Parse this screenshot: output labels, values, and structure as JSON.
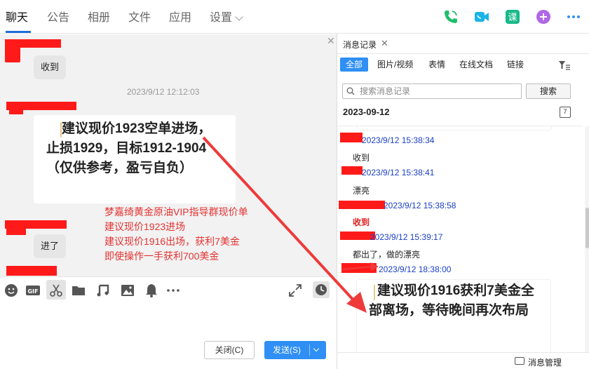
{
  "tabs": [
    {
      "label": "聊天",
      "active": true
    },
    {
      "label": "公告"
    },
    {
      "label": "相册"
    },
    {
      "label": "文件"
    },
    {
      "label": "应用"
    },
    {
      "label": "设置"
    }
  ],
  "top_icons": [
    "phone-icon",
    "video-call-icon",
    "lesson-icon",
    "add-app-icon",
    "more-icon"
  ],
  "chat": {
    "bubble1": "收到",
    "timestamp": "2023/9/12 12:12:03",
    "card_text": "建议现价1923空单进场，止损1929，目标1912-1904（仅供参考，盈亏自负）",
    "bubble2": "进了",
    "overlay_lines": [
      "梦嘉绮黄金原油VIP指导群现价单",
      "建议现价1923进场",
      "建议现价1916出场，获利7美金",
      "即使操作一手获利700美金"
    ]
  },
  "toolbar_icons": [
    "emoji-icon",
    "gif-icon",
    "scissors-icon",
    "folder-icon",
    "music-icon",
    "image-icon",
    "bell-icon",
    "more-dots-icon",
    "expand-icon",
    "clock-icon"
  ],
  "buttons": {
    "close": "关闭(C)",
    "send": "发送(S)"
  },
  "history": {
    "tab_label": "消息记录",
    "filters": [
      "全部",
      "图片/视频",
      "表情",
      "在线文档",
      "链接"
    ],
    "search_placeholder": "搜索消息记录",
    "search_button": "搜索",
    "date": "2023-09-12",
    "calendar_day": "7",
    "entries": [
      {
        "time": "2023/9/12 15:38:34",
        "text": "收到"
      },
      {
        "time": "2023/9/12 15:38:41",
        "text": "漂亮"
      },
      {
        "time": "2023/9/12 15:38:58",
        "text": "收到"
      },
      {
        "time": "2023/9/12 15:39:17",
        "text": "都出了，做的漂亮"
      },
      {
        "time": "2023/9/12 18:38:00",
        "text": ""
      }
    ],
    "card_text": "建议现价1916获利7美金全部离场，等待晚间再次布局",
    "footer": "消息管理"
  },
  "colors": {
    "accent": "#2f8ff5",
    "redact": "#ff1a1a",
    "annotation": "#e53232"
  }
}
